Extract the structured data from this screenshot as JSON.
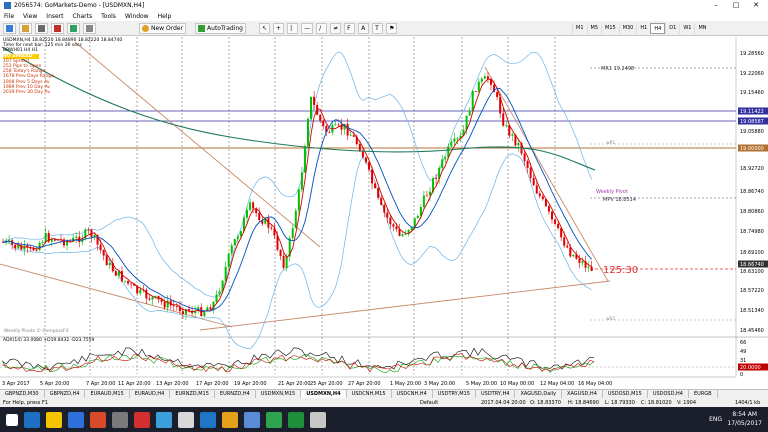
{
  "window": {
    "title": "2056574: GoMarkets-Demo - [USDMXN,H4]",
    "minimize": "–",
    "maximize": "□",
    "close": "✕"
  },
  "menu": [
    "File",
    "View",
    "Insert",
    "Charts",
    "Tools",
    "Window",
    "Help"
  ],
  "toolbar": {
    "new_order": "New Order",
    "autotrading": "AutoTrading",
    "timeframes": [
      "M1",
      "M5",
      "M15",
      "M30",
      "H1",
      "H4",
      "D1",
      "W1",
      "MN"
    ]
  },
  "chart": {
    "symbol_header": "USDMXN,H4  18.82220 18.84890 18.82220 18.84740",
    "timer_line": "Time for next bar: 125 min 30 secs",
    "indicator_line": "BBWH01 H4 H1",
    "spread_tag": "NO SPREAD",
    "info": [
      {
        "label": "107 Spread",
        "color": "#cc3300"
      },
      {
        "label": "252 Pips to Open",
        "color": "#cc3300"
      },
      {
        "label": "258 Today's Range",
        "color": "#cc3300"
      },
      {
        "label": "1678 Prev Days Range",
        "color": "#cc3300"
      },
      {
        "label": "1908 Prev 5 Days Av",
        "color": "#cc3300"
      },
      {
        "label": "1989 Prev 10 Day Av",
        "color": "#cc3300"
      },
      {
        "label": "2039 Prev 30 Day Av",
        "color": "#cc3300"
      }
    ],
    "price_labels": [
      "19.28560",
      "19.22060",
      "19.15460",
      "19.11422",
      "19.08587",
      "19.05880",
      "19.00000",
      "18.92720",
      "18.86740",
      "18.80860",
      "18.74980",
      "18.69100",
      "18.66740",
      "18.63100",
      "18.57220",
      "18.51340",
      "18.45460"
    ],
    "annotations": {
      "mr1": "MR1  19.2498",
      "wp1": "wP1",
      "weekly_pivot": "Weekly Pivot",
      "mpv": "MPV  18.8514",
      "ws1": "wS1",
      "countdown": "125:30",
      "watermark": "Weekly Pivots © CompassFX"
    },
    "adx_header": "ADX(14) 33.0080 +D19.8432 -D23.7559",
    "adx_labels": [
      "66",
      "49",
      "31",
      "20.0000",
      "0"
    ],
    "x_labels": [
      "3 Apr 2017",
      "5 Apr 20:00",
      "7 Apr 20:00",
      "11 Apr 20:00",
      "13 Apr 20:00",
      "17 Apr 20:00",
      "19 Apr 20:00",
      "21 Apr 20:00",
      "25 Apr 20:00",
      "27 Apr 20:00",
      "1 May 20:00",
      "3 May 20:00",
      "5 May 20:00",
      "10 May 00:00",
      "12 May 04:00",
      "16 May 04:00"
    ]
  },
  "tabs": [
    "GBPNZD,M30",
    "GBPNZD,H4",
    "EURAUD,M15",
    "EURAUD,H4",
    "EURNZD,M15",
    "EURNZD,H4",
    "USDMXN,M15",
    "USDMXN,H4",
    "USDCNH,M15",
    "USDCNH,H4",
    "USDTRY,M15",
    "USDTRY,H4",
    "XAGUSD,Daily",
    "XAGUSD,H4",
    "USDOSD,M15",
    "USDOSD,H4",
    "EURGB"
  ],
  "active_tab": "USDMXN,H4",
  "status": {
    "help": "For Help, press F1",
    "profile": "Default",
    "datetime": "2017.04.04 20:00",
    "open": "O: 18.83370",
    "high": "H: 18.84690",
    "low": "L: 18.79330",
    "close": "C: 18.81020",
    "volume": "V: 1904",
    "traffic": "1404/1 kb"
  },
  "tray": {
    "lang": "ENG",
    "time": "8:54 AM",
    "date": "17/05/2017"
  },
  "colors": {
    "bg": "#ffffff",
    "up": "#00c000",
    "down": "#e00000",
    "ema_fast": "#d00000",
    "ema_mid": "#0050c0",
    "ema_slow": "#1e7a5a",
    "bands": "#6ab4e8",
    "trend": "#c88a6a"
  }
}
